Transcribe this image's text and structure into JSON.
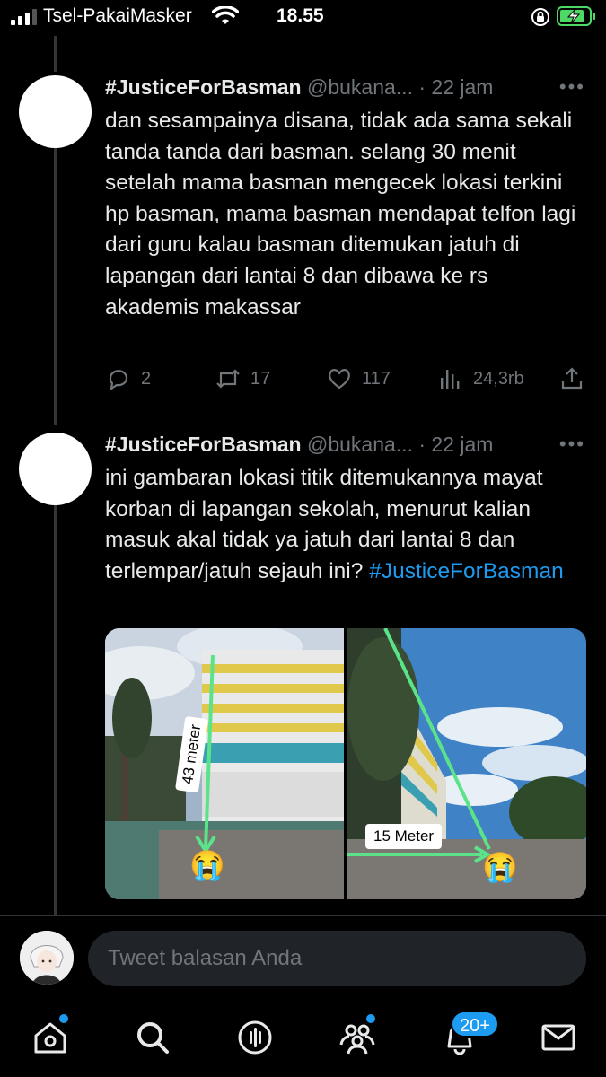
{
  "status_bar": {
    "carrier": "Tsel-PakaiMasker",
    "time": "18.55",
    "icons": [
      "signal-icon",
      "wifi-icon",
      "orientation-lock-icon",
      "battery-charging-icon"
    ]
  },
  "tweets": [
    {
      "name": "#JusticeForBasman",
      "handle": "@bukana...",
      "separator": "·",
      "time": "22 jam",
      "text": "dan sesampainya disana, tidak ada sama sekali tanda tanda dari basman. selang 30 menit setelah mama basman mengecek lokasi terkini hp basman, mama basman mendapat telfon lagi dari guru kalau basman ditemukan jatuh di lapangan dari lantai 8 dan dibawa ke rs akademis makassar",
      "replies": "2",
      "retweets": "17",
      "likes": "117",
      "views": "24,3rb"
    },
    {
      "name": "#JusticeForBasman",
      "handle": "@bukana...",
      "separator": "·",
      "time": "22 jam",
      "text": "ini gambaran lokasi titik ditemukannya mayat korban di lapangan sekolah, menurut kalian masuk akal tidak ya jatuh dari lantai 8 dan terlempar/jatuh sejauh ini?",
      "hashtag": "#JusticeForBasman",
      "photos": [
        {
          "label": "43 meter",
          "emoji": "😭"
        },
        {
          "label": "15 Meter",
          "emoji": "😭"
        }
      ]
    }
  ],
  "reply": {
    "placeholder": "Tweet balasan Anda"
  },
  "nav": {
    "notifications_badge": "20+",
    "items": [
      "home-icon",
      "search-icon",
      "spaces-icon",
      "communities-icon",
      "notifications-icon",
      "messages-icon"
    ]
  },
  "colors": {
    "background": "#000000",
    "accent": "#1d9bf0",
    "muted": "#71767b"
  }
}
